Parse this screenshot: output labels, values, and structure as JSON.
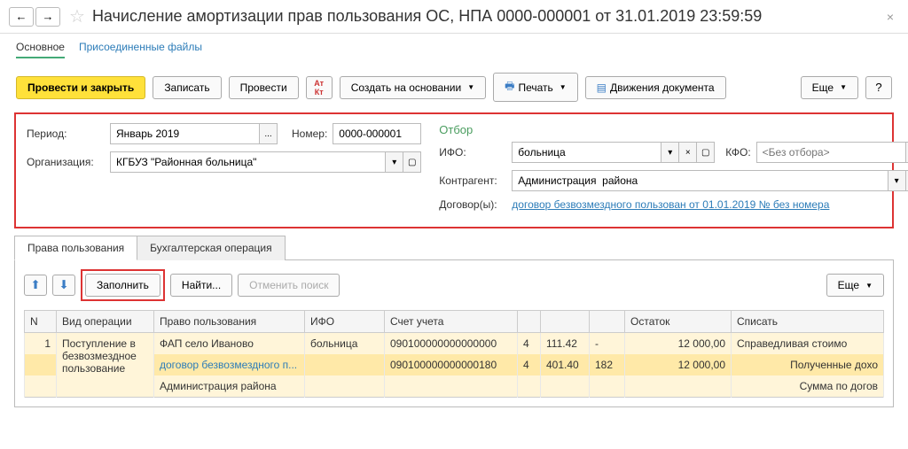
{
  "header": {
    "title": "Начисление амортизации прав пользования ОС, НПА 0000-000001 от 31.01.2019 23:59:59"
  },
  "subtabs": {
    "main": "Основное",
    "attached": "Присоединенные файлы"
  },
  "toolbar": {
    "post_close": "Провести и закрыть",
    "save": "Записать",
    "post": "Провести",
    "create_based": "Создать на основании",
    "print": "Печать",
    "movements": "Движения документа",
    "more": "Еще",
    "help": "?"
  },
  "filter": {
    "period_label": "Период:",
    "period_value": "Январь 2019",
    "number_label": "Номер:",
    "number_value": "0000-000001",
    "org_label": "Организация:",
    "org_value": "КГБУЗ \"Районная больница\"",
    "selection_title": "Отбор",
    "ifo_label": "ИФО:",
    "ifo_value": "больница",
    "kfo_label": "КФО:",
    "kfo_placeholder": "<Без отбора>",
    "counterparty_label": "Контрагент:",
    "counterparty_value": "Администрация  района",
    "contracts_label": "Договор(ы):",
    "contracts_value": "договор безвозмездного пользован от 01.01.2019 № без номера"
  },
  "tabs": {
    "rights": "Права пользования",
    "accounting": "Бухгалтерская операция"
  },
  "tab_toolbar": {
    "fill": "Заполнить",
    "find": "Найти...",
    "cancel_find": "Отменить поиск",
    "more": "Еще"
  },
  "grid": {
    "headers": {
      "n": "N",
      "op_type": "Вид операции",
      "right": "Право пользования",
      "ifo": "ИФО",
      "account": "Счет учета",
      "c1": "",
      "c2": "",
      "c3": "",
      "balance": "Остаток",
      "write_off": "Списать"
    },
    "rows": [
      {
        "n": "1",
        "op_type": "Поступление в безвозмездное пользование",
        "right": "ФАП село Иваново",
        "ifo": "больница",
        "account": "090100000000000000",
        "c1": "4",
        "c2": "111.42",
        "c3": "-",
        "balance": "12 000,00",
        "write_off": "Справедливая стоимо"
      },
      {
        "n": "",
        "op_type": "",
        "right": "договор безвозмездного п...",
        "ifo": "",
        "account": "090100000000000180",
        "c1": "4",
        "c2": "401.40",
        "c3": "182",
        "balance": "12 000,00",
        "write_off": "Полученные дохо"
      },
      {
        "n": "",
        "op_type": "",
        "right": "Администрация  района",
        "ifo": "",
        "account": "",
        "c1": "",
        "c2": "",
        "c3": "",
        "balance": "",
        "write_off": "Сумма по догов"
      }
    ]
  }
}
